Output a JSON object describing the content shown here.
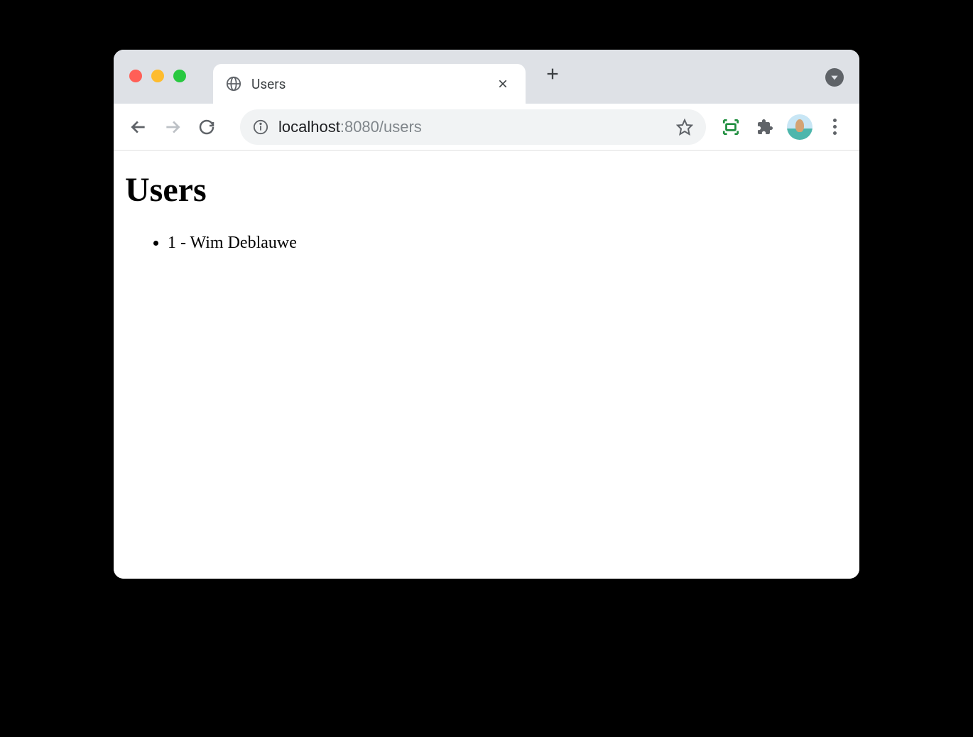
{
  "tab": {
    "title": "Users"
  },
  "address": {
    "host": "localhost",
    "port_path": ":8080/users"
  },
  "page": {
    "heading": "Users",
    "users": [
      "1 - Wim Deblauwe"
    ]
  }
}
